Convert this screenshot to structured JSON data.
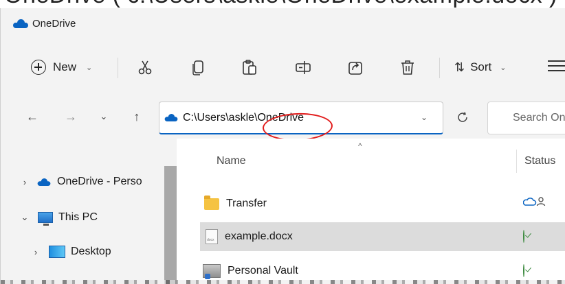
{
  "top_caption": "OneDrive ( c:\\Users\\askle\\OneDrive\\example.docx )",
  "window": {
    "title": "OneDrive",
    "icon": "onedrive-cloud-icon"
  },
  "toolbar": {
    "new_label": "New",
    "sort_label": "Sort",
    "buttons": [
      "cut-icon",
      "copy-icon",
      "paste-icon",
      "rename-icon",
      "share-icon",
      "delete-icon"
    ]
  },
  "navigation": {
    "address_path": "C:\\Users\\askle\\OneDrive",
    "search_placeholder": "Search OneDrive"
  },
  "sidebar": {
    "items": [
      {
        "label": "OneDrive - Perso",
        "chevron": "›"
      },
      {
        "label": "This PC",
        "chevron": "⌄"
      },
      {
        "label": "Desktop",
        "chevron": "›"
      }
    ]
  },
  "file_list": {
    "columns": {
      "name": "Name",
      "status": "Status"
    },
    "rows": [
      {
        "name": "Transfer",
        "status": "cloud-person-icon"
      },
      {
        "name": "example.docx",
        "status": "check-icon",
        "selected": true
      },
      {
        "name": "Personal Vault",
        "status": "check-icon"
      }
    ]
  },
  "colors": {
    "accent": "#0a64c2",
    "highlight_oval": "#e21c1c",
    "selected_row": "#dcdcdc",
    "status_ok": "#3b8a3e"
  }
}
